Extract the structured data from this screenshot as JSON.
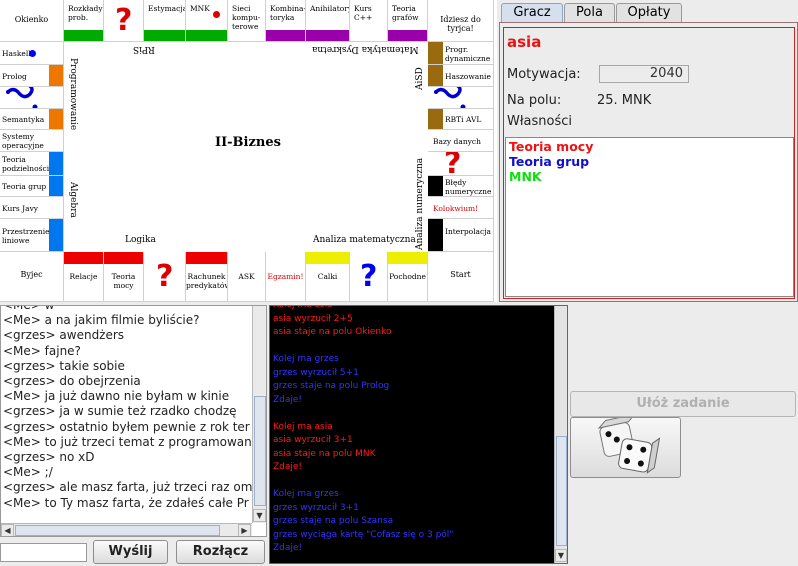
{
  "board": {
    "center_title": "II-Biznes",
    "top_row": [
      {
        "label": "Okienko"
      },
      {
        "label": "Rozkłady prob.",
        "color": "#00aa00"
      },
      {
        "label": "",
        "icon": "question-icon",
        "color": "#dd0000"
      },
      {
        "label": "Estymacja",
        "color": "#00aa00"
      },
      {
        "label": "MNK",
        "color": "#00aa00",
        "marker": "#dd0000"
      },
      {
        "label": "Sieci kompu-terowe"
      },
      {
        "label": "Kombina-toryka",
        "color": "#9900aa"
      },
      {
        "label": "Anihilatory",
        "color": "#9900aa"
      },
      {
        "label": "Kurs C++"
      },
      {
        "label": "Teoria grafów",
        "color": "#9900aa"
      },
      {
        "label": "Idziesz do tyrjca!"
      }
    ],
    "top_inner_labels": [
      "RPiS",
      "Matematyka Dyskretna"
    ],
    "left_column": [
      {
        "label": "Haskell",
        "marker": "#0000ff"
      },
      {
        "label": "Prolog",
        "color": "#ee7700"
      },
      {
        "label": "",
        "icon": "wave-icon",
        "color": "#0000cc"
      },
      {
        "label": "Semantyka",
        "color": "#ee7700"
      },
      {
        "label": "Systemy operacyjne"
      },
      {
        "label": "Teoria podzielności",
        "color": "#0077ee"
      },
      {
        "label": "Teoria grup",
        "color": "#0077ee"
      },
      {
        "label": "Kurs Javy"
      },
      {
        "label": "Przestrzenie liniowe",
        "color": "#0077ee"
      }
    ],
    "left_inner_labels": [
      "Programowanie",
      "Algebra"
    ],
    "right_column": [
      {
        "label": "Progr. dynamiczne",
        "color": "#9a6a10"
      },
      {
        "label": "Haszowanie",
        "color": "#9a6a10"
      },
      {
        "label": "",
        "icon": "wave-icon",
        "color": "#0000cc"
      },
      {
        "label": "RBTi AVL",
        "color": "#9a6a10"
      },
      {
        "label": "Bazy danych"
      },
      {
        "label": "",
        "icon": "question-icon",
        "color": "#dd0000"
      },
      {
        "label": "Błędy numeryczne",
        "color": "#000000"
      },
      {
        "label": "Kolokwium!",
        "text_color": "#dd0000"
      },
      {
        "label": "Interpolacja",
        "color": "#000000"
      }
    ],
    "right_inner_labels": [
      "AiSD",
      "Analiza numeryczna"
    ],
    "bottom_row": [
      {
        "label": "Byjec"
      },
      {
        "label": "Relacje",
        "color": "#ee0000"
      },
      {
        "label": "Teoria mocy",
        "color": "#ee0000"
      },
      {
        "label": "",
        "icon": "question-icon",
        "color": "#dd0000"
      },
      {
        "label": "Rachunek predykatów",
        "color": "#ee0000"
      },
      {
        "label": "ASK"
      },
      {
        "label": "Egzamin!",
        "text_color": "#dd0000"
      },
      {
        "label": "Calki",
        "color": "#eeee00"
      },
      {
        "label": "",
        "icon": "question-icon",
        "color": "#0000ee"
      },
      {
        "label": "Pochodne",
        "color": "#eeee00"
      },
      {
        "label": "Start"
      }
    ],
    "bottom_inner_labels": [
      "Logika",
      "Analiza matematyczna"
    ]
  },
  "tabs": [
    {
      "label": "Gracz",
      "active": true
    },
    {
      "label": "Pola",
      "active": false
    },
    {
      "label": "Opłaty",
      "active": false
    }
  ],
  "player": {
    "name": "asia",
    "motivation_label": "Motywacja:",
    "motivation_value": "2040",
    "field_label": "Na polu:",
    "field_value": "25. MNK",
    "properties_label": "Własności",
    "properties": [
      {
        "name": "Teoria mocy",
        "color": "#ee1111"
      },
      {
        "name": "Teoria grup",
        "color": "#1111cc"
      },
      {
        "name": "MNK",
        "color": "#11dd11"
      }
    ]
  },
  "chat": {
    "lines": [
      "<Me> w",
      "<Me> a na jakim filmie byliście?",
      "<grzes> awendżers",
      "<Me> fajne?",
      "<grzes> takie sobie",
      "<grzes> do obejrzenia",
      "<Me> ja już dawno nie byłam w kinie",
      "<grzes> ja w sumie też rzadko chodzę",
      "<grzes> ostatnio byłem pewnie z rok ter",
      "<Me> to już trzeci temat z programowan",
      "<grzes> no xD",
      "<Me> ;/",
      "<grzes> ale masz farta, już trzeci raz om",
      "<Me> to Ty masz farta, że zdałeś całe Pr"
    ],
    "input_value": "",
    "send_label": "Wyślij",
    "disconnect_label": "Rozłącz"
  },
  "log": {
    "lines": [
      {
        "text": "Kolej ma asia",
        "color": "red"
      },
      {
        "text": "asia wyrzucił 2+5",
        "color": "red"
      },
      {
        "text": "asia staje na polu Okienko",
        "color": "red"
      },
      {
        "text": "",
        "color": "red"
      },
      {
        "text": "Kolej ma grzes",
        "color": "blue"
      },
      {
        "text": "grzes wyrzucił 5+1",
        "color": "blue"
      },
      {
        "text": "grzes staje na polu Prolog",
        "color": "blue"
      },
      {
        "text": "Zdaje!",
        "color": "blue"
      },
      {
        "text": "",
        "color": "red"
      },
      {
        "text": "Kolej ma asia",
        "color": "red"
      },
      {
        "text": "asia wyrzucił 3+1",
        "color": "red"
      },
      {
        "text": "asia staje na polu MNK",
        "color": "red"
      },
      {
        "text": "Zdaje!",
        "color": "red"
      },
      {
        "text": "",
        "color": "red"
      },
      {
        "text": "Kolej ma grzes",
        "color": "blue"
      },
      {
        "text": "grzes wyrzucił 3+1",
        "color": "blue"
      },
      {
        "text": "grzes staje na polu Szansa",
        "color": "blue"
      },
      {
        "text": "grzes wyciąga kartę \"Cofasz się o 3 pól\"",
        "color": "blue"
      },
      {
        "text": "Zdaje!",
        "color": "blue"
      }
    ]
  },
  "controls": {
    "task_label": "Ułóż zadanie",
    "dice_icon": "dice-icon"
  }
}
